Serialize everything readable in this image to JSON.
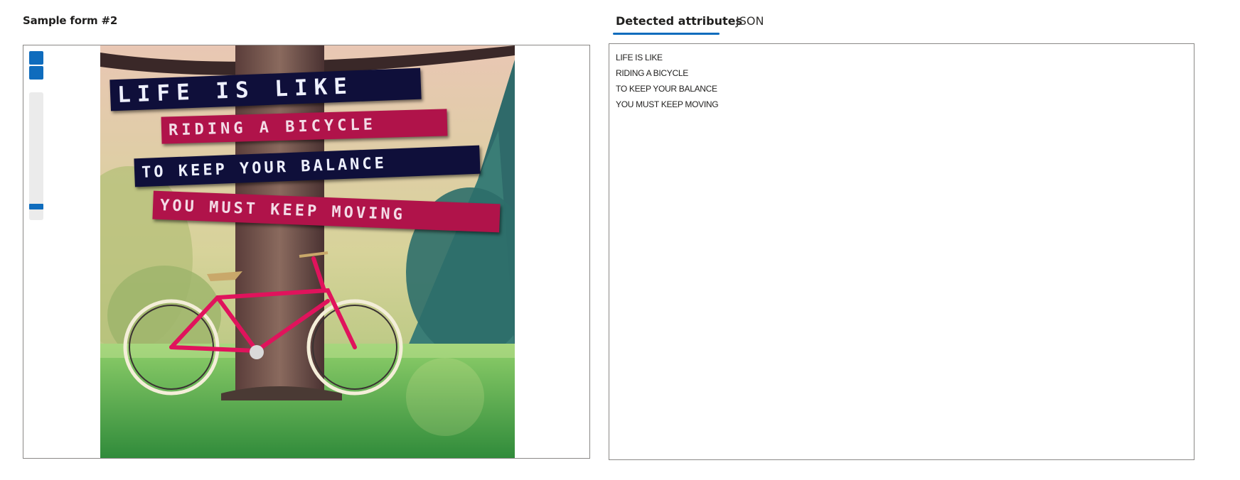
{
  "form": {
    "title": "Sample form #2"
  },
  "image": {
    "lines": [
      {
        "text": "LIFE IS LIKE",
        "label_color": "#0f0f3a"
      },
      {
        "text": "RIDING A BICYCLE",
        "label_color": "#b0134a"
      },
      {
        "text": "TO KEEP YOUR BALANCE",
        "label_color": "#0f0f3a"
      },
      {
        "text": "YOU MUST KEEP MOVING",
        "label_color": "#b0134a"
      }
    ],
    "bike_color": "#e0135c",
    "grass_color": "#3f9a3a"
  },
  "zoom": {
    "level": 0.05
  },
  "tabs": {
    "attributes": "Detected attributes",
    "json": "JSON",
    "active": "attributes"
  },
  "attributes": {
    "lines": [
      "LIFE IS LIKE",
      "RIDING A BICYCLE",
      "TO KEEP YOUR BALANCE",
      "YOU MUST KEEP MOVING"
    ]
  },
  "colors": {
    "accent": "#0f6cbd",
    "border": "#8a8886"
  }
}
